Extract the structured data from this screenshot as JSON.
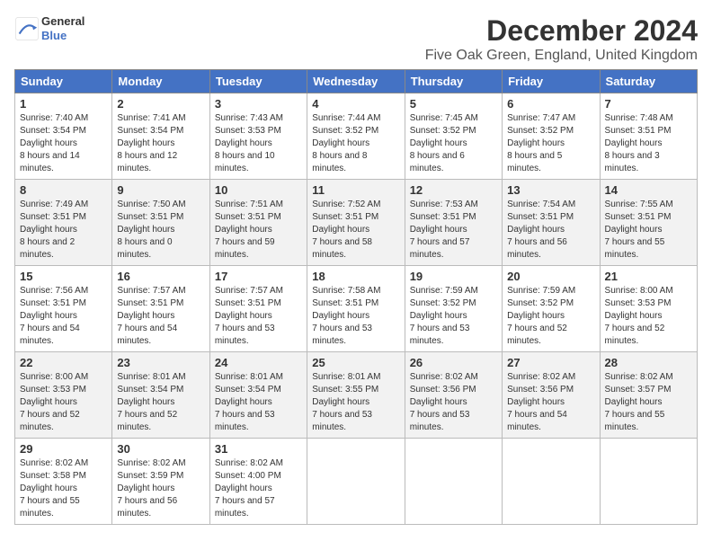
{
  "header": {
    "logo_line1": "General",
    "logo_line2": "Blue",
    "title": "December 2024",
    "subtitle": "Five Oak Green, England, United Kingdom"
  },
  "weekdays": [
    "Sunday",
    "Monday",
    "Tuesday",
    "Wednesday",
    "Thursday",
    "Friday",
    "Saturday"
  ],
  "weeks": [
    [
      {
        "day": "1",
        "sunrise": "7:40 AM",
        "sunset": "3:54 PM",
        "daylight": "8 hours and 14 minutes."
      },
      {
        "day": "2",
        "sunrise": "7:41 AM",
        "sunset": "3:54 PM",
        "daylight": "8 hours and 12 minutes."
      },
      {
        "day": "3",
        "sunrise": "7:43 AM",
        "sunset": "3:53 PM",
        "daylight": "8 hours and 10 minutes."
      },
      {
        "day": "4",
        "sunrise": "7:44 AM",
        "sunset": "3:52 PM",
        "daylight": "8 hours and 8 minutes."
      },
      {
        "day": "5",
        "sunrise": "7:45 AM",
        "sunset": "3:52 PM",
        "daylight": "8 hours and 6 minutes."
      },
      {
        "day": "6",
        "sunrise": "7:47 AM",
        "sunset": "3:52 PM",
        "daylight": "8 hours and 5 minutes."
      },
      {
        "day": "7",
        "sunrise": "7:48 AM",
        "sunset": "3:51 PM",
        "daylight": "8 hours and 3 minutes."
      }
    ],
    [
      {
        "day": "8",
        "sunrise": "7:49 AM",
        "sunset": "3:51 PM",
        "daylight": "8 hours and 2 minutes."
      },
      {
        "day": "9",
        "sunrise": "7:50 AM",
        "sunset": "3:51 PM",
        "daylight": "8 hours and 0 minutes."
      },
      {
        "day": "10",
        "sunrise": "7:51 AM",
        "sunset": "3:51 PM",
        "daylight": "7 hours and 59 minutes."
      },
      {
        "day": "11",
        "sunrise": "7:52 AM",
        "sunset": "3:51 PM",
        "daylight": "7 hours and 58 minutes."
      },
      {
        "day": "12",
        "sunrise": "7:53 AM",
        "sunset": "3:51 PM",
        "daylight": "7 hours and 57 minutes."
      },
      {
        "day": "13",
        "sunrise": "7:54 AM",
        "sunset": "3:51 PM",
        "daylight": "7 hours and 56 minutes."
      },
      {
        "day": "14",
        "sunrise": "7:55 AM",
        "sunset": "3:51 PM",
        "daylight": "7 hours and 55 minutes."
      }
    ],
    [
      {
        "day": "15",
        "sunrise": "7:56 AM",
        "sunset": "3:51 PM",
        "daylight": "7 hours and 54 minutes."
      },
      {
        "day": "16",
        "sunrise": "7:57 AM",
        "sunset": "3:51 PM",
        "daylight": "7 hours and 54 minutes."
      },
      {
        "day": "17",
        "sunrise": "7:57 AM",
        "sunset": "3:51 PM",
        "daylight": "7 hours and 53 minutes."
      },
      {
        "day": "18",
        "sunrise": "7:58 AM",
        "sunset": "3:51 PM",
        "daylight": "7 hours and 53 minutes."
      },
      {
        "day": "19",
        "sunrise": "7:59 AM",
        "sunset": "3:52 PM",
        "daylight": "7 hours and 53 minutes."
      },
      {
        "day": "20",
        "sunrise": "7:59 AM",
        "sunset": "3:52 PM",
        "daylight": "7 hours and 52 minutes."
      },
      {
        "day": "21",
        "sunrise": "8:00 AM",
        "sunset": "3:53 PM",
        "daylight": "7 hours and 52 minutes."
      }
    ],
    [
      {
        "day": "22",
        "sunrise": "8:00 AM",
        "sunset": "3:53 PM",
        "daylight": "7 hours and 52 minutes."
      },
      {
        "day": "23",
        "sunrise": "8:01 AM",
        "sunset": "3:54 PM",
        "daylight": "7 hours and 52 minutes."
      },
      {
        "day": "24",
        "sunrise": "8:01 AM",
        "sunset": "3:54 PM",
        "daylight": "7 hours and 53 minutes."
      },
      {
        "day": "25",
        "sunrise": "8:01 AM",
        "sunset": "3:55 PM",
        "daylight": "7 hours and 53 minutes."
      },
      {
        "day": "26",
        "sunrise": "8:02 AM",
        "sunset": "3:56 PM",
        "daylight": "7 hours and 53 minutes."
      },
      {
        "day": "27",
        "sunrise": "8:02 AM",
        "sunset": "3:56 PM",
        "daylight": "7 hours and 54 minutes."
      },
      {
        "day": "28",
        "sunrise": "8:02 AM",
        "sunset": "3:57 PM",
        "daylight": "7 hours and 55 minutes."
      }
    ],
    [
      {
        "day": "29",
        "sunrise": "8:02 AM",
        "sunset": "3:58 PM",
        "daylight": "7 hours and 55 minutes."
      },
      {
        "day": "30",
        "sunrise": "8:02 AM",
        "sunset": "3:59 PM",
        "daylight": "7 hours and 56 minutes."
      },
      {
        "day": "31",
        "sunrise": "8:02 AM",
        "sunset": "4:00 PM",
        "daylight": "7 hours and 57 minutes."
      },
      null,
      null,
      null,
      null
    ]
  ]
}
